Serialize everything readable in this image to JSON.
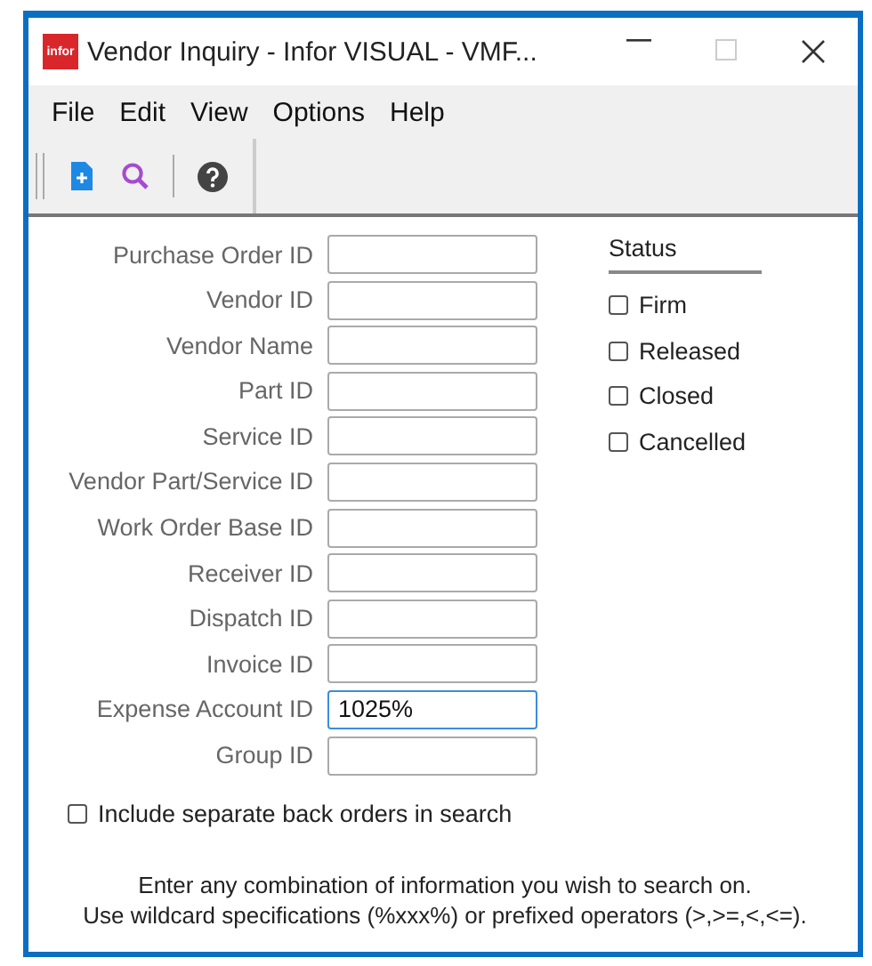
{
  "window": {
    "title": "Vendor Inquiry - Infor VISUAL - VMF...",
    "logo": "infor"
  },
  "menu": [
    "File",
    "Edit",
    "View",
    "Options",
    "Help"
  ],
  "toolbar": [
    {
      "kind": "new"
    },
    {
      "kind": "search"
    },
    {
      "kind": "help"
    }
  ],
  "fields": [
    {
      "label": "Purchase Order ID",
      "focused": false
    },
    {
      "label": "Vendor ID",
      "focused": false
    },
    {
      "label": "Vendor Name",
      "focused": false
    },
    {
      "label": "Part ID",
      "focused": false
    },
    {
      "label": "Service ID",
      "focused": false
    },
    {
      "label": "Vendor Part/Service ID",
      "focused": false
    },
    {
      "label": "Work Order Base ID",
      "focused": false
    },
    {
      "label": "Receiver ID",
      "focused": false
    },
    {
      "label": "Dispatch ID",
      "focused": false
    },
    {
      "label": "Invoice ID",
      "focused": false
    },
    {
      "label": "Expense Account ID",
      "value": "1025%",
      "focused": true
    },
    {
      "label": "Group ID",
      "focused": false
    }
  ],
  "status": {
    "title": "Status",
    "options": [
      {
        "label": "Firm",
        "checked": false
      },
      {
        "label": "Released",
        "checked": false
      },
      {
        "label": "Closed",
        "checked": false
      },
      {
        "label": "Cancelled",
        "checked": false
      }
    ]
  },
  "include_back_orders": {
    "label": "Include separate back orders in search",
    "checked": false
  },
  "hint": [
    "Enter any combination of information you wish to search on.",
    "Use wildcard specifications (%xxx%) or prefixed operators (>,>=,<,<=)."
  ]
}
